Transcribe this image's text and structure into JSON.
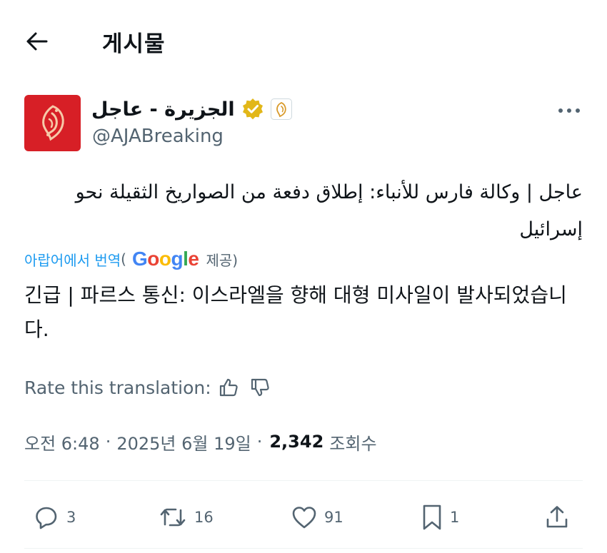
{
  "header": {
    "title": "게시물",
    "back_icon": "arrow-left-icon"
  },
  "author": {
    "name": "الجزيرة - عاجل",
    "handle": "@AJABreaking",
    "verified_badge_color": "#e2b719",
    "avatar_color": "#d71f26"
  },
  "tweet": {
    "original_text": "عاجل | وكالة فارس للأنباء: إطلاق دفعة من الصواريخ الثقيلة نحو إسرائيل",
    "translated_by_prefix": "아랍어에서 번역",
    "open_paren": "(",
    "google_logo": "Google",
    "provided_suffix": "제공)",
    "translated_text": "긴급 | 파르스 통신: 이스라엘을 향해 대형 미사일이 발사되었습니다."
  },
  "rate": {
    "label": "Rate this translation:"
  },
  "meta": {
    "time": "오전 6:48",
    "separator": "·",
    "date": "2025년 6월 19일",
    "views_count": "2,342",
    "views_label": "조회수"
  },
  "actions": {
    "replies": "3",
    "reposts": "16",
    "likes": "91",
    "bookmarks": "1"
  },
  "colors": {
    "link": "#1d9bf0",
    "secondary": "#536471",
    "text": "#0f1419"
  }
}
